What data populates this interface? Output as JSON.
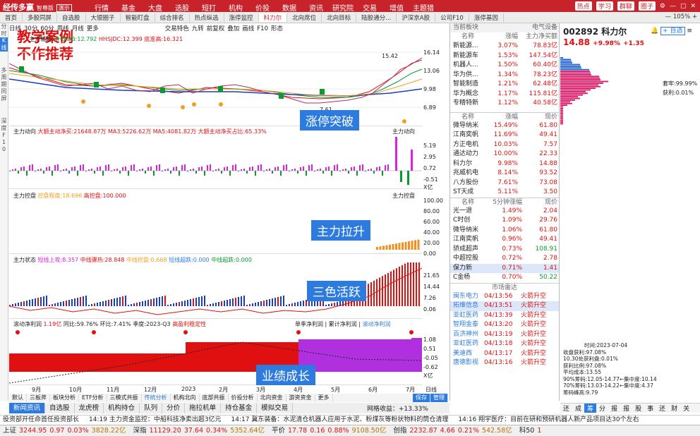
{
  "app": {
    "name": "经传多赢",
    "edition": "智尊版",
    "mode": "演示"
  },
  "menu": [
    "行情",
    "基金",
    "大盘",
    "选股",
    "短打",
    "机构",
    "价投",
    "数据",
    "资讯",
    "研究院",
    "交易",
    "增值",
    "主题猎手"
  ],
  "top_right": {
    "hot": "热点",
    "study": "学习",
    "contact": "群聊",
    "circle": "圈子"
  },
  "tabs": [
    "首页",
    "多股同屏",
    "自选股",
    "大银圈子",
    "智能盯盘",
    "综合排名",
    "热点纵选",
    "涨停监控",
    "科力尔",
    "北向席位",
    "北向目标",
    "陆股通分...",
    "沪深京A股",
    "公司F10",
    "涨停基因"
  ],
  "zoom": "105%",
  "left_strip": [
    "分",
    "时",
    "K",
    "线",
    "多",
    "周",
    "期",
    "同",
    "屏",
    "深",
    "度",
    "F",
    "1",
    "0"
  ],
  "chart_toolbar": [
    "日线",
    "30分",
    "60分",
    "周线",
    "月线",
    "更多",
    "交易特色",
    "九转",
    "前复权",
    "叠加",
    "画线",
    "F10",
    "形态"
  ],
  "watermark": [
    "教学案例",
    "不作推荐"
  ],
  "panels": {
    "k": {
      "title": "主力辅助",
      "items": [
        "HHSJDB:12.792",
        "HHSJDC:12.399",
        "底准高:16.321"
      ],
      "axis": [
        "16.14",
        "13.06",
        "9.98",
        "6.89"
      ],
      "high": "15.42",
      "low": "7.61",
      "callout": "涨停突破"
    },
    "flow": {
      "title": "主力动向",
      "items": [
        "大额主动净买:21648.87万",
        "MA3:5226.62万",
        "MA5:4081.82万",
        "大额主动净买占比:65.33%"
      ],
      "right": "主力动向",
      "axis": [
        "5.19",
        "2.95",
        "0.72",
        "-0.51"
      ],
      "unit": "X亿",
      "callout": ""
    },
    "control": {
      "title": "主力控盘",
      "items": [
        "控盘程度:18.696",
        "高控盘:100.000"
      ],
      "right": "主力控盘",
      "axis": [
        "100.00",
        "80.00",
        "60.00",
        "40.00",
        "20.00",
        "0.00"
      ],
      "callout": "主力拉升"
    },
    "status": {
      "title": "主力状态",
      "items": [
        "短线上攻:8.357",
        "中线骤热:28.848",
        "中线控盘:0.668",
        "短线超跌:0.000",
        "中线超跌:0.000"
      ],
      "axis": [
        "21.65",
        "14.44",
        "7.26",
        "0.06"
      ],
      "callout": "三色活跃"
    },
    "profit": {
      "title": "滚动净利润",
      "items": [
        "1.19亿",
        "同比:59.76%",
        "环比:7.41%",
        "季度:2023-Q3",
        "高盈利稳定性"
      ],
      "tabs": [
        "单季净利润",
        "累计净利润",
        "滚动净利润"
      ],
      "axis": [
        "1.08",
        "0.51",
        "-0.05",
        "-0.62"
      ],
      "unit": "X亿",
      "callout": "业绩成长"
    }
  },
  "xaxis": [
    "9月",
    "10月",
    "11月",
    "12月",
    "2023",
    "2月",
    "3月",
    "4月",
    "5月",
    "6月",
    "7月",
    "日线"
  ],
  "chart_bottom_tabs": [
    "默认",
    "三板斧",
    "板块分析",
    "ETF分析",
    "三模式共振",
    "传统分析",
    "机构北向",
    "底部共振",
    "价投分析",
    "北向资金",
    "游资资金",
    "更多",
    "保存",
    "管理"
  ],
  "sector": {
    "headers": [
      "当前板块",
      "电气设备"
    ],
    "cols": [
      "名称",
      "涨幅",
      "主力净买额"
    ],
    "rows": [
      [
        "新能源...",
        "3.07%",
        "78.83亿"
      ],
      [
        "新能源车",
        "1.53%",
        "147.54亿"
      ],
      [
        "机器人...",
        "1.50%",
        "60.40亿"
      ],
      [
        "华为供...",
        "1.34%",
        "78.23亿"
      ],
      [
        "智能制造",
        "1.21%",
        "62.48亿"
      ],
      [
        "华为概念",
        "1.17%",
        "115.81亿"
      ],
      [
        "专精特新",
        "1.12%",
        "40.58亿"
      ]
    ]
  },
  "stocks": {
    "cols": [
      "名称",
      "涨幅",
      "现价"
    ],
    "rows": [
      [
        "微导纳米",
        "15.49%",
        "61.80"
      ],
      [
        "江南奕帆",
        "11.69%",
        "49.41"
      ],
      [
        "方正电机",
        "10.03%",
        "7.57"
      ],
      [
        "通达动力",
        "10.00%",
        "22.33"
      ],
      [
        "科力尔",
        "9.98%",
        "14.88"
      ],
      [
        "兆威机电",
        "8.14%",
        "93.52"
      ],
      [
        "八方股份",
        "7.61%",
        "73.08"
      ],
      [
        "ST天成",
        "5.11%",
        "3.50"
      ]
    ]
  },
  "speed": {
    "cols": [
      "名称",
      "5分钟涨幅",
      "现价"
    ],
    "rows": [
      [
        "光一退",
        "1.49%",
        "2.04"
      ],
      [
        "C时创",
        "1.09%",
        "29.76"
      ],
      [
        "微导纳米",
        "1.06%",
        "61.80"
      ],
      [
        "江南奕帆",
        "0.96%",
        "49.41"
      ],
      [
        "骄成超声",
        "0.73%",
        "108.91"
      ],
      [
        "中超控股",
        "0.72%",
        "2.78"
      ],
      [
        "保力新",
        "0.71%",
        "1.41"
      ],
      [
        "C金杨",
        "0.70%",
        "50.22"
      ]
    ]
  },
  "radar": {
    "title": "市场雷达",
    "rows": [
      [
        "闽东电力",
        "04/13:56",
        "火箭升空"
      ],
      [
        "拓维信息",
        "04/13:51",
        "火箭升空"
      ],
      [
        "亚虹医药",
        "04/13:39",
        "火箭升空"
      ],
      [
        "智翔金泰",
        "04/13:20",
        "火箭升空"
      ],
      [
        "百济神州",
        "04/13:19",
        "火箭升空"
      ],
      [
        "亚虹医药",
        "04/13:18",
        "火箭升空"
      ],
      [
        "美迪西",
        "04/13:17",
        "火箭升空"
      ],
      [
        "唐德影视",
        "04/13:16",
        "火箭升空"
      ]
    ]
  },
  "quote": {
    "code": "002892",
    "name": "科力尔",
    "price": "14.88",
    "pct": "+9.98%",
    "chg": "+1.35",
    "add": "+ 自选",
    "profit_pct": "获利:0.01%",
    "cost_label": "套牢:99.99%",
    "date": "时间:2023-07-04",
    "info": [
      "收盘获利:97.08%",
      "10.30处获利盘:0.01%",
      "获利比例:97.08%",
      "平均成本:13.55",
      "90%筹码:12.05-14.77←集中度:10.14",
      "70%筹码:13.03-14.22←集中度:4.37",
      "筹码峰高:9.79"
    ],
    "tabs": [
      "还",
      "成",
      "筹",
      "分",
      "报",
      "报",
      "股",
      "事",
      "还",
      "财",
      "关"
    ]
  },
  "bottom_tabs": [
    "新闻资讯",
    "自选股",
    "龙虎榜",
    "机构持仓",
    "队列",
    "分价",
    "拖拉机单",
    "持仓基金",
    "模拟交易"
  ],
  "grid_perf": "网格收益：+13.33%",
  "ticker": [
    "役资部开任命首任投资部长",
    "14:19 主力资金监控：中船科技净卖出超3亿元",
    "14:17 冀东装备：水泥清仓机器人应用于水泥、粉煤灰等粉状物料的筒仓清理",
    "14:16 翔宇医疗：目前在研和预研机器人新产品项目达30个左右"
  ],
  "status": [
    {
      "n": "上证",
      "v": "3244.95",
      "c": "0.97",
      "p": "0.03%",
      "a": "3828.22亿"
    },
    {
      "n": "深指",
      "v": "11129.20",
      "c": "37.64",
      "p": "0.34%",
      "a": "5352.64亿"
    },
    {
      "n": "平价",
      "v": "17.78",
      "c": "0.16",
      "p": "0.88%",
      "a": "9108.50亿"
    },
    {
      "n": "创指",
      "v": "2232.87",
      "c": "4.66",
      "p": "0.21%",
      "a": "542.58亿"
    },
    {
      "n": "科50",
      "v": "1",
      "c": "",
      "p": "",
      "a": ""
    }
  ],
  "colors": {
    "red": "#e01010",
    "green": "#0a9a30",
    "blue": "#2e7be0",
    "brand": "#c8232b",
    "magenta": "#e020e0"
  }
}
